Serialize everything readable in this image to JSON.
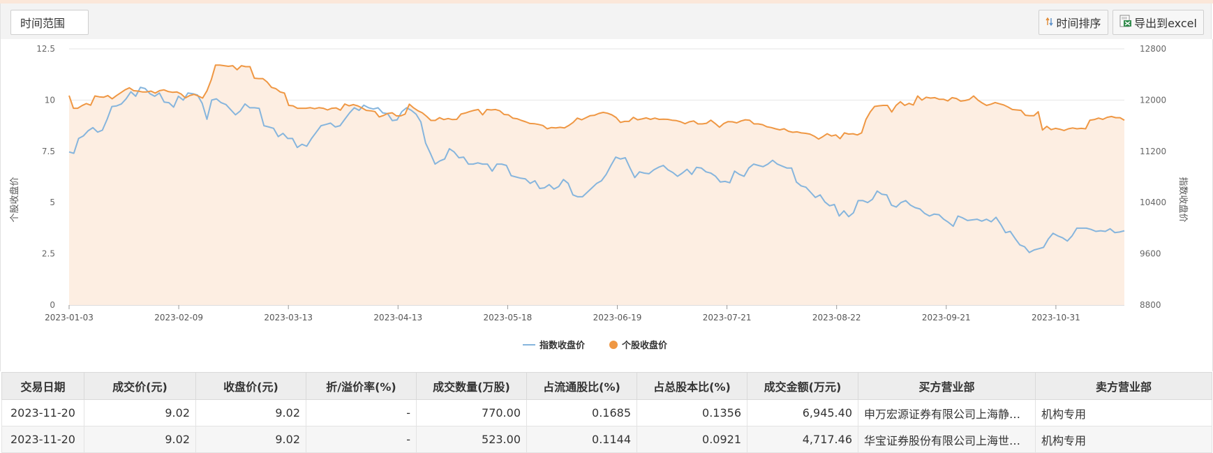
{
  "toolbar": {
    "range_label": "时间范围",
    "sort_label": "时间排序",
    "export_label": "导出到excel"
  },
  "colors": {
    "index_line": "#86b5dd",
    "stock_line": "#ef9743",
    "stock_area": "#fdeee2"
  },
  "chart_data": {
    "type": "line",
    "x_ticks": [
      "2023-01-03",
      "2023-02-09",
      "2023-03-13",
      "2023-04-13",
      "2023-05-18",
      "2023-06-19",
      "2023-07-21",
      "2023-08-22",
      "2023-09-21",
      "2023-10-31"
    ],
    "ylabel": "个股收盘价",
    "y2label": "指数收盘价",
    "ylim": [
      0,
      12.5
    ],
    "y2lim": [
      8800,
      12800
    ],
    "y_ticks": [
      "0",
      "2.5",
      "5",
      "7.5",
      "10",
      "12.5"
    ],
    "y2_ticks": [
      "8800",
      "9600",
      "10400",
      "11200",
      "12000",
      "12800"
    ],
    "legend_position": "bottom-center",
    "series": [
      {
        "name": "指数收盘价",
        "axis": "right",
        "area": false,
        "values": [
          11190,
          11170,
          11400,
          11440,
          11520,
          11570,
          11500,
          11530,
          11700,
          11900,
          11910,
          11940,
          12020,
          12130,
          12060,
          12200,
          12180,
          12100,
          12060,
          12110,
          11970,
          11960,
          11890,
          12060,
          12000,
          12110,
          12100,
          12080,
          11950,
          11700,
          12000,
          12020,
          11960,
          11930,
          11850,
          11770,
          11830,
          11940,
          11880,
          11880,
          11870,
          11600,
          11580,
          11560,
          11430,
          11480,
          11400,
          11400,
          11260,
          11310,
          11280,
          11400,
          11500,
          11600,
          11620,
          11640,
          11580,
          11600,
          11700,
          11800,
          11880,
          11840,
          11920,
          11880,
          11860,
          11880,
          11800,
          11790,
          11680,
          11690,
          11820,
          11880,
          11840,
          11780,
          11660,
          11330,
          11170,
          11000,
          11050,
          11080,
          11240,
          11190,
          11100,
          11110,
          11000,
          11000,
          11020,
          11000,
          11000,
          10890,
          11000,
          11000,
          10980,
          10820,
          10800,
          10780,
          10770,
          10700,
          10740,
          10620,
          10630,
          10680,
          10610,
          10650,
          10760,
          10700,
          10520,
          10490,
          10490,
          10560,
          10630,
          10700,
          10740,
          10840,
          10980,
          11110,
          11080,
          11100,
          10940,
          10790,
          10880,
          10860,
          10850,
          10910,
          10950,
          10980,
          10910,
          10870,
          10810,
          10860,
          10920,
          10840,
          10950,
          10940,
          10880,
          10860,
          10810,
          10720,
          10730,
          10710,
          10890,
          10840,
          10810,
          10940,
          11000,
          10980,
          10960,
          11000,
          11060,
          11000,
          10970,
          10940,
          10940,
          10720,
          10660,
          10640,
          10560,
          10480,
          10520,
          10410,
          10350,
          10370,
          10190,
          10270,
          10180,
          10240,
          10430,
          10430,
          10400,
          10450,
          10580,
          10530,
          10520,
          10360,
          10330,
          10400,
          10430,
          10360,
          10320,
          10300,
          10230,
          10190,
          10220,
          10210,
          10140,
          10090,
          10030,
          10190,
          10160,
          10120,
          10130,
          10140,
          10110,
          10140,
          10100,
          10170,
          10060,
          9930,
          9950,
          9840,
          9740,
          9710,
          9620,
          9660,
          9680,
          9700,
          9830,
          9920,
          9880,
          9850,
          9800,
          9880,
          10000,
          10000,
          10000,
          9980,
          9950,
          9960,
          9950,
          9990,
          9930,
          9940,
          9960
        ]
      },
      {
        "name": "个股收盘价",
        "axis": "left",
        "area": true,
        "values": [
          10.22,
          9.6,
          9.6,
          9.73,
          9.83,
          9.75,
          10.2,
          10.16,
          10.14,
          10.22,
          10.06,
          10.22,
          10.36,
          10.5,
          10.6,
          10.46,
          10.44,
          10.4,
          10.4,
          10.44,
          10.34,
          10.46,
          10.5,
          10.42,
          10.38,
          10.4,
          10.3,
          10.11,
          10.22,
          10.28,
          10.2,
          10.1,
          10.45,
          10.99,
          11.71,
          11.71,
          11.68,
          11.65,
          11.68,
          11.48,
          11.68,
          11.63,
          11.63,
          11.07,
          11.05,
          11.05,
          10.88,
          10.62,
          10.56,
          10.4,
          10.34,
          9.74,
          9.72,
          9.6,
          9.6,
          9.6,
          9.63,
          9.58,
          9.63,
          9.6,
          9.52,
          9.6,
          9.62,
          9.51,
          9.81,
          9.72,
          9.78,
          9.72,
          9.62,
          9.5,
          9.48,
          9.44,
          9.18,
          9.25,
          9.35,
          9.38,
          9.23,
          9.23,
          9.32,
          9.8,
          9.62,
          9.48,
          9.38,
          9.21,
          9.01,
          9.01,
          9.14,
          9.05,
          9.1,
          9.05,
          9.06,
          9.32,
          9.37,
          9.44,
          9.5,
          9.54,
          9.28,
          9.54,
          9.52,
          9.54,
          9.48,
          9.3,
          9.28,
          9.12,
          9.09,
          9.01,
          8.94,
          8.86,
          8.85,
          8.81,
          8.76,
          8.6,
          8.66,
          8.64,
          8.67,
          8.64,
          8.76,
          8.91,
          9.12,
          9.04,
          9.14,
          9.24,
          9.26,
          9.35,
          9.4,
          9.36,
          9.28,
          9.15,
          8.91,
          8.96,
          8.96,
          9.16,
          9.04,
          9.08,
          9.13,
          9.06,
          9.12,
          9.06,
          9.07,
          9.06,
          9.02,
          9.0,
          8.94,
          8.85,
          8.94,
          8.98,
          8.84,
          8.84,
          8.87,
          9.02,
          8.86,
          8.68,
          8.86,
          8.95,
          8.94,
          8.89,
          8.98,
          9.04,
          9.02,
          8.84,
          8.84,
          8.8,
          8.7,
          8.66,
          8.6,
          8.55,
          8.6,
          8.48,
          8.43,
          8.45,
          8.4,
          8.38,
          8.34,
          8.24,
          8.1,
          8.22,
          8.36,
          8.25,
          8.3,
          8.12,
          8.4,
          8.34,
          8.36,
          8.3,
          8.4,
          9.05,
          9.42,
          9.69,
          9.72,
          9.74,
          9.74,
          9.42,
          9.74,
          9.92,
          9.74,
          9.84,
          9.76,
          10.2,
          10.0,
          10.14,
          10.1,
          10.12,
          10.04,
          10.04,
          9.96,
          10.12,
          10.08,
          9.95,
          9.98,
          10.03,
          10.2,
          10.0,
          9.86,
          9.74,
          9.8,
          9.88,
          9.82,
          9.76,
          9.66,
          9.54,
          9.52,
          9.5,
          9.26,
          9.24,
          9.24,
          9.43,
          8.54,
          8.72,
          8.56,
          8.62,
          8.58,
          8.52,
          8.6,
          8.64,
          8.6,
          8.62,
          8.6,
          9.02,
          9.05,
          9.12,
          9.06,
          9.16,
          9.2,
          9.14,
          9.14,
          9.02
        ]
      }
    ]
  },
  "table": {
    "headers": [
      "交易日期",
      "成交价(元)",
      "收盘价(元)",
      "折/溢价率(%)",
      "成交数量(万股)",
      "占流通股比(%)",
      "占总股本比(%)",
      "成交金额(万元)",
      "买方营业部",
      "卖方营业部"
    ],
    "rows": [
      [
        "2023-11-20",
        "9.02",
        "9.02",
        "-",
        "770.00",
        "0.1685",
        "0.1356",
        "6,945.40",
        "申万宏源证券有限公司上海静安区新闸路证券营业部",
        "机构专用"
      ],
      [
        "2023-11-20",
        "9.02",
        "9.02",
        "-",
        "523.00",
        "0.1144",
        "0.0921",
        "4,717.46",
        "华宝证券股份有限公司上海世纪大道证券营业部",
        "机构专用"
      ]
    ]
  }
}
